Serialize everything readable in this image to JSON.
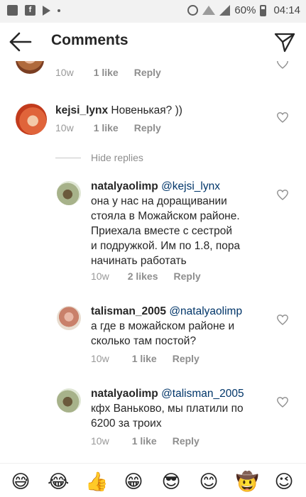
{
  "status_bar": {
    "battery": "60%",
    "time": "04:14"
  },
  "header": {
    "title": "Comments"
  },
  "comments": [
    {
      "meta": {
        "time": "10w",
        "likes": "1 like",
        "reply": "Reply"
      }
    },
    {
      "username": "kejsi_lynx",
      "text": "Новенькая? ))",
      "meta": {
        "time": "10w",
        "likes": "1 like",
        "reply": "Reply"
      }
    }
  ],
  "hide_replies": "Hide replies",
  "replies": [
    {
      "username": "natalyaolimp",
      "mention": "@kejsi_lynx",
      "lines": [
        "она у нас на доращивании",
        "стояла в Можайском районе.",
        "Приехала вместе с сестрой",
        "и подружкой. Им по 1.8, пора",
        "начинать работать"
      ],
      "meta": {
        "time": "10w",
        "likes": "2 likes",
        "reply": "Reply"
      }
    },
    {
      "username": "talisman_2005",
      "mention": "@natalyaolimp",
      "lines": [
        "а где в можайском районе и",
        "сколько там постой?"
      ],
      "meta": {
        "time": "10w",
        "likes": "1 like",
        "reply": "Reply"
      }
    },
    {
      "username": "natalyaolimp",
      "mention": "@talisman_2005",
      "lines": [
        "кфх Ваньково, мы платили по",
        "6200 за троих"
      ],
      "meta": {
        "time": "10w",
        "likes": "1 like",
        "reply": "Reply"
      }
    }
  ],
  "emoji_bar": [
    "😅",
    "😂",
    "👍",
    "😁",
    "😎",
    "😊",
    "🤠",
    "😉"
  ],
  "colors": {
    "text": "#262626",
    "meta": "#8e8e8e",
    "mention": "#003569"
  }
}
